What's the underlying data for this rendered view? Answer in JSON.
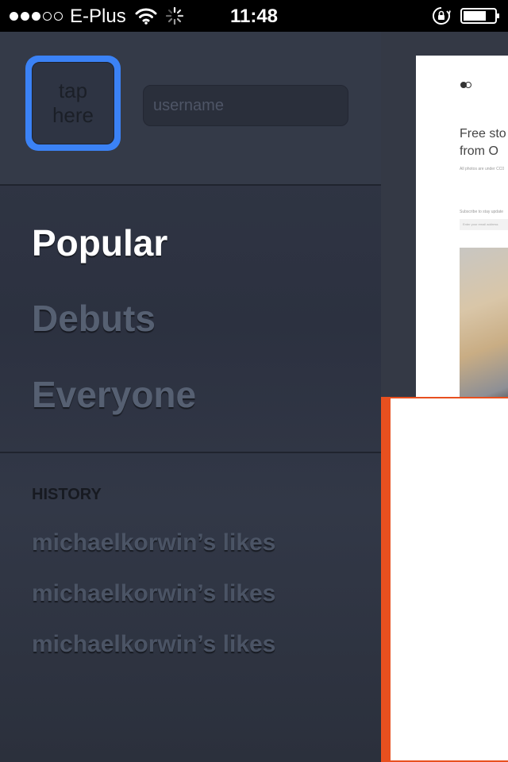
{
  "status_bar": {
    "carrier": "E-Plus",
    "time": "11:48",
    "signal_bars_filled": 3,
    "signal_bars_total": 5,
    "icons": [
      "wifi-icon",
      "activity-spinner-icon",
      "rotation-lock-icon",
      "battery-icon"
    ]
  },
  "profile": {
    "avatar_label": "tap\nhere",
    "avatar_accent": "#3b82f6",
    "username_placeholder": "username",
    "username_value": ""
  },
  "nav": {
    "items": [
      {
        "label": "Popular",
        "active": true
      },
      {
        "label": "Debuts",
        "active": false
      },
      {
        "label": "Everyone",
        "active": false
      }
    ]
  },
  "history": {
    "header": "HISTORY",
    "items": [
      {
        "label": "michaelkorwin’s likes"
      },
      {
        "label": "michaelkorwin’s likes"
      },
      {
        "label": "michaelkorwin’s likes"
      }
    ]
  },
  "preview": {
    "headline_line1": "Free sto",
    "headline_line2": "from O",
    "subtext": "All photos are under CC0",
    "subscribe_text": "Subscribe to stay update",
    "email_placeholder": "Enter your email address",
    "accent": "#e8501f"
  }
}
